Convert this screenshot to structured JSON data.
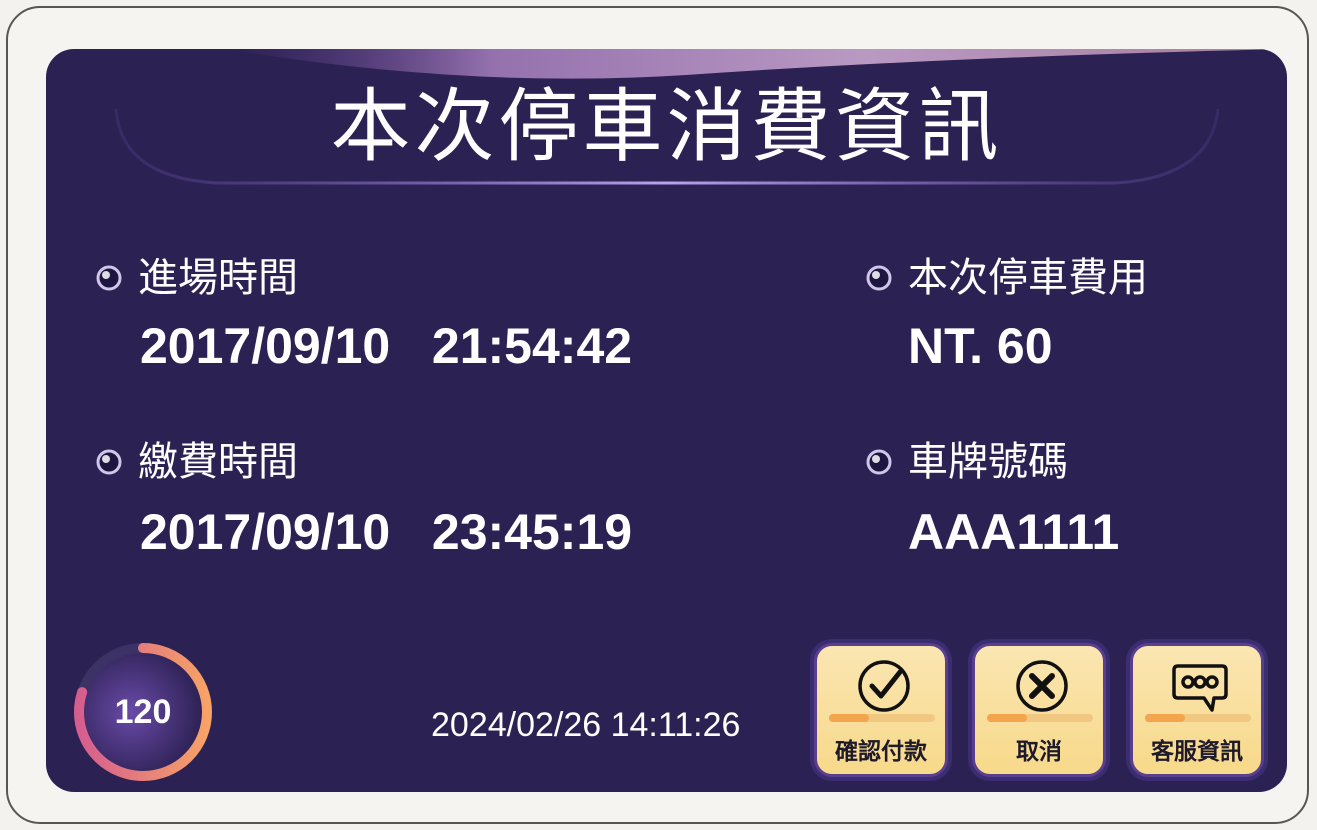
{
  "title": "本次停車消費資訊",
  "entry": {
    "label": "進場時間",
    "value": "2017/09/10   21:54:42"
  },
  "payment": {
    "label": "繳費時間",
    "value": "2017/09/10   23:45:19"
  },
  "fee": {
    "label": "本次停車費用",
    "value": "NT. 60"
  },
  "plate": {
    "label": "車牌號碼",
    "value": "AAA1111"
  },
  "timer": {
    "value": "120",
    "progress": 0.8
  },
  "clock": "2024/02/26 14:11:26",
  "buttons": {
    "confirm": {
      "label": "確認付款",
      "icon": "check-circle-icon"
    },
    "cancel": {
      "label": "取消",
      "icon": "x-circle-icon"
    },
    "service": {
      "label": "客服資訊",
      "icon": "chat-bubble-icon"
    }
  },
  "colors": {
    "background": "#2c2153",
    "button": "#f7d98a",
    "timer_ring": "#f49a6a"
  }
}
